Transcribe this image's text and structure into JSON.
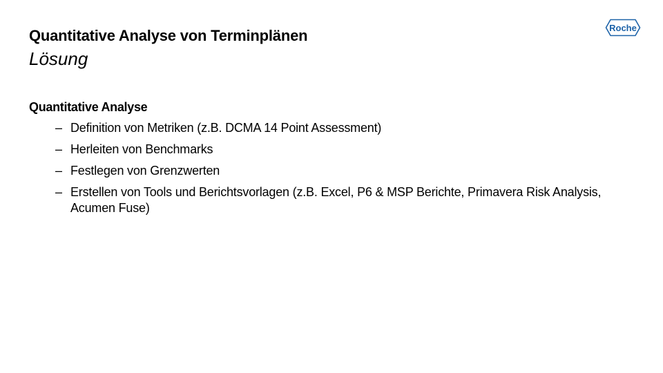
{
  "header": {
    "title": "Quantitative Analyse von Terminplänen",
    "subtitle": "Lösung",
    "logo": {
      "text": "Roche",
      "icon": "roche-hexagon-logo",
      "color": "#1c62a8"
    }
  },
  "body": {
    "section_heading": "Quantitative Analyse",
    "bullet_marker": "–",
    "items": [
      {
        "text": "Definition von Metriken (z.B. DCMA 14 Point Assessment)"
      },
      {
        "text": "Herleiten von Benchmarks"
      },
      {
        "text": "Festlegen von Grenzwerten"
      },
      {
        "text": "Erstellen von Tools und Berichtsvorlagen (z.B. Excel, P6 & MSP Berichte, Primavera Risk Analysis, Acumen Fuse)"
      }
    ]
  }
}
